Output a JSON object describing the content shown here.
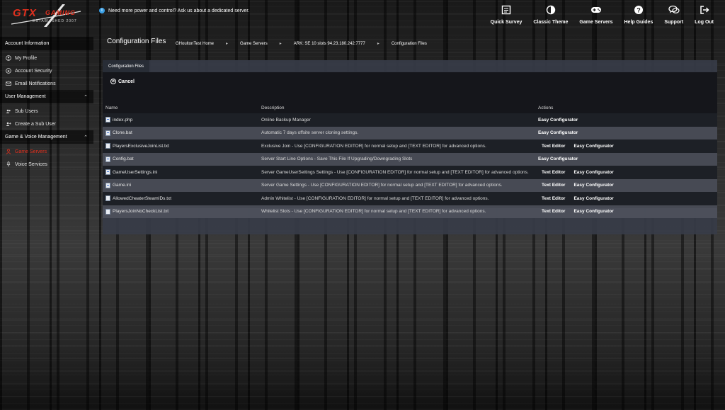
{
  "logo": {
    "text": "GTX",
    "sub": "GAMING",
    "est": "ESTABLISHED 2007"
  },
  "notice": "Need more power and control? Ask us about a dedicated server.",
  "topnav": [
    {
      "label": "Quick Survey",
      "icon": "survey-icon"
    },
    {
      "label": "Classic Theme",
      "icon": "theme-icon"
    },
    {
      "label": "Game Servers",
      "icon": "gamepad-icon"
    },
    {
      "label": "Help Guides",
      "icon": "help-icon"
    },
    {
      "label": "Support",
      "icon": "chat-icon"
    },
    {
      "label": "Log Out",
      "icon": "logout-icon"
    }
  ],
  "sidebar": {
    "sections": [
      {
        "title": "Account Information",
        "items": [
          "My Profile",
          "Account Security",
          "Email Notifications"
        ]
      },
      {
        "title": "User Management",
        "items": [
          "Sub Users",
          "Create a Sub User"
        ]
      },
      {
        "title": "Game & Voice Management",
        "items": [
          "Game Servers",
          "Voice Services"
        ]
      }
    ]
  },
  "page": {
    "title": "Configuration Files",
    "breadcrumbs": [
      "GHoultonTest Home",
      "Game Servers",
      "ARK: SE 10 slots 94.23.180.242:7777",
      "Configuration Files"
    ]
  },
  "panel": {
    "tab": "Configuration Files",
    "cancel": "Cancel",
    "columns": {
      "name": "Name",
      "description": "Description",
      "actions": "Actions"
    },
    "rows": [
      {
        "name": "index.php",
        "description": "Online Backup Manager",
        "actions": [
          "Easy Configurator"
        ]
      },
      {
        "name": "Clone.bat",
        "description": "Automatic 7 days offsite server cloning settings.",
        "actions": [
          "Easy Configurator"
        ]
      },
      {
        "name": "PlayersExclusiveJoinList.txt",
        "description": "Exclusive Join - Use [CONFIGURATION EDITOR] for normal setup and [TEXT EDITOR] for advanced options.",
        "actions": [
          "Text Editor",
          "Easy Configurator"
        ]
      },
      {
        "name": "Config.bat",
        "description": "Server Start Line Options - Save This File If Upgrading/Downgrading Slots",
        "actions": [
          "Easy Configurator"
        ]
      },
      {
        "name": "GameUserSettings.ini",
        "description": "Server GameUserSettings Settings - Use [CONFIGURATION EDITOR] for normal setup and [TEXT EDITOR] for advanced options.",
        "actions": [
          "Text Editor",
          "Easy Configurator"
        ]
      },
      {
        "name": "Game.ini",
        "description": "Server Game Settings - Use [CONFIGURATION EDITOR] for normal setup and [TEXT EDITOR] for advanced options.",
        "actions": [
          "Text Editor",
          "Easy Configurator"
        ]
      },
      {
        "name": "AllowedCheaterSteamIDs.txt",
        "description": "Admin Whitelist - Use [CONFIGURATION EDITOR] for normal setup and [TEXT EDITOR] for advanced options.",
        "actions": [
          "Text Editor",
          "Easy Configurator"
        ]
      },
      {
        "name": "PlayersJoinNoCheckList.txt",
        "description": "Whitelist Slots - Use [CONFIGURATION EDITOR] for normal setup and [TEXT EDITOR] for advanced options.",
        "actions": [
          "Text Editor",
          "Easy Configurator"
        ]
      }
    ]
  },
  "colors": {
    "accent": "#e0301e",
    "panel": "#373c48"
  }
}
